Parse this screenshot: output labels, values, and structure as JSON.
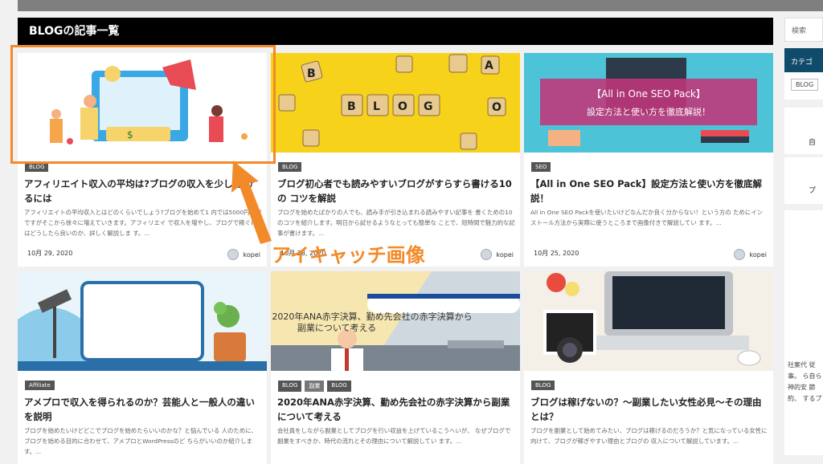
{
  "section_title": "BLOGの記事一覧",
  "sidebar": {
    "search_placeholder": "検索",
    "category_header": "カテゴ",
    "tag": "BLOG",
    "box1": "自",
    "box2": "プ",
    "para": "社案代 従事。 ら自ら 神的安 節約、 するプ"
  },
  "annotation": {
    "text": "アイキャッチ画像"
  },
  "cards": [
    {
      "cats": [
        "BLOG"
      ],
      "title": "アフィリエイト収入の平均は?ブログの収入を少し 上げるには",
      "excerpt": "アフィリエイトの平均収入とはどのくらいでしょう?ブログを始めて1 内では5000円程度ですがそこから徐々に増えていきます。アフィリエイ で収入を増やし、ブログで稼ぐにはどうしたら良いのか、詳しく解説しま す。...",
      "date": "10月 29, 2020",
      "author": "kopei"
    },
    {
      "cats": [
        "BLOG"
      ],
      "title": "ブログ初心者でも読みやすいブログがすらすら書ける10の コツを解説",
      "excerpt": "ブログを始めたばかりの人でも、読み手が引き込まれる読みやすい記事を 書くための10のコツを紹介します。明日から試せるようなとっても簡単な ことで、短時間で魅力的な記事が書けます。...",
      "date": "10月 28, 2020",
      "author": "kopei"
    },
    {
      "cats": [
        "SEO"
      ],
      "title": "【All in One SEO Pack】設定方法と使い方を徹底解 説！",
      "excerpt": "All in One SEO Packを使いたいけどなんだか良く分からない！という方の ためにインストール方法から実際に使うところまで画像付きで解説してい ます。...",
      "date": "10月 25, 2020",
      "author": "kopei",
      "thumb_text": "【All in One SEO Pack】 設定方法と使い方を徹底解説！"
    },
    {
      "cats": [
        "Affiliate"
      ],
      "title": "アメプロで収入を得られるのか？芸能人と一般人の違い を説明",
      "excerpt": "ブログを始めたいけどどこでブログを始めたらいいのかな？と悩んでいる 人のために、ブログを始める目的に合わせて、アメプロとWordPressのど ちらがいいのか紹介します。..."
    },
    {
      "cats": [
        "BLOG",
        "副業",
        "BLOG"
      ],
      "title": "2020年ANA赤字決算、勤め先会社の赤字決算から副業 について考える",
      "excerpt": "会社員をしながら副業としてブログを行い収益を上げているこうへいが、 なぜブログで副業をすべきか、時代の流れとその理由について解説してい ます。...",
      "thumb_text": "2020年ANA赤字決算、勤め先会社の赤字決算から 副業について考える"
    },
    {
      "cats": [
        "BLOG"
      ],
      "title": "ブログは稼げないの？〜副業したい女性必見〜その理由 とは？",
      "excerpt": "ブログを副業として始めてみたい、ブログは稼げるのだろうか？と気になっている女性に向けて、ブログが稼ぎやすい理由とブログの 収入について解説しています。..."
    }
  ]
}
